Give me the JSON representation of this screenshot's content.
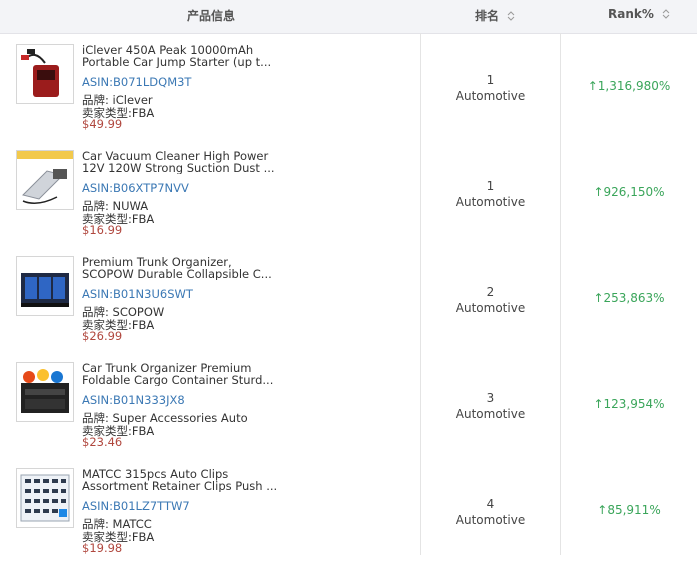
{
  "header": {
    "product": "产品信息",
    "rank": "排名",
    "rank_pct": "Rank%"
  },
  "colors": {
    "rank_up": "#3aa55a",
    "asin": "#3b78b4",
    "price": "#b0473e"
  },
  "rows": [
    {
      "title": "iClever 450A Peak 10000mAh Portable Car Jump Starter (up t...",
      "asin": "ASIN:B071LDQM3T",
      "brand": "品牌: iClever",
      "seller": "卖家类型:FBA",
      "price": "$49.99",
      "rank": "1",
      "category": "Automotive",
      "arrow": "↑",
      "rank_pct": "1,316,980%",
      "image": "jump-starter-image"
    },
    {
      "title": "Car Vacuum Cleaner High Power 12V 120W Strong Suction Dust ...",
      "asin": "ASIN:B06XTP7NVV",
      "brand": "品牌: NUWA",
      "seller": "卖家类型:FBA",
      "price": "$16.99",
      "rank": "1",
      "category": "Automotive",
      "arrow": "↑",
      "rank_pct": "926,150%",
      "image": "car-vacuum-image"
    },
    {
      "title": "Premium Trunk Organizer, SCOPOW Durable Collapsible C...",
      "asin": "ASIN:B01N3U6SWT",
      "brand": "品牌: SCOPOW",
      "seller": "卖家类型:FBA",
      "price": "$26.99",
      "rank": "2",
      "category": "Automotive",
      "arrow": "↑",
      "rank_pct": "253,863%",
      "image": "trunk-organizer-image"
    },
    {
      "title": "Car Trunk Organizer Premium Foldable Cargo Container Sturd...",
      "asin": "ASIN:B01N333JX8",
      "brand": "品牌: Super Accessories Auto",
      "seller": "卖家类型:FBA",
      "price": "$23.46",
      "rank": "3",
      "category": "Automotive",
      "arrow": "↑",
      "rank_pct": "123,954%",
      "image": "cargo-container-image"
    },
    {
      "title": "MATCC 315pcs Auto Clips Assortment Retainer Clips Push ...",
      "asin": "ASIN:B01LZ7TTW7",
      "brand": "品牌: MATCC",
      "seller": "卖家类型:FBA",
      "price": "$19.98",
      "rank": "4",
      "category": "Automotive",
      "arrow": "↑",
      "rank_pct": "85,911%",
      "image": "auto-clips-image"
    }
  ]
}
